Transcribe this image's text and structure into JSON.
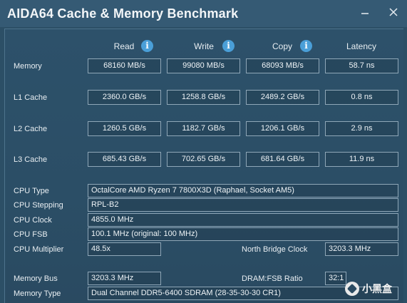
{
  "window": {
    "title": "AIDA64 Cache & Memory Benchmark"
  },
  "columns": {
    "read": "Read",
    "write": "Write",
    "copy": "Copy",
    "latency": "Latency"
  },
  "rows": {
    "memory": {
      "label": "Memory",
      "read": "68160 MB/s",
      "write": "99080 MB/s",
      "copy": "68093 MB/s",
      "latency": "58.7 ns"
    },
    "l1": {
      "label": "L1 Cache",
      "read": "2360.0 GB/s",
      "write": "1258.8 GB/s",
      "copy": "2489.2 GB/s",
      "latency": "0.8 ns"
    },
    "l2": {
      "label": "L2 Cache",
      "read": "1260.5 GB/s",
      "write": "1182.7 GB/s",
      "copy": "1206.1 GB/s",
      "latency": "2.9 ns"
    },
    "l3": {
      "label": "L3 Cache",
      "read": "685.43 GB/s",
      "write": "702.65 GB/s",
      "copy": "681.64 GB/s",
      "latency": "11.9 ns"
    }
  },
  "info": {
    "cpu_type": {
      "label": "CPU Type",
      "value": "OctalCore AMD Ryzen 7 7800X3D  (Raphael, Socket AM5)"
    },
    "cpu_stepping": {
      "label": "CPU Stepping",
      "value": "RPL-B2"
    },
    "cpu_clock": {
      "label": "CPU Clock",
      "value": "4855.0 MHz"
    },
    "cpu_fsb": {
      "label": "CPU FSB",
      "value": "100.1 MHz  (original: 100 MHz)"
    },
    "cpu_multiplier": {
      "label": "CPU Multiplier",
      "value": "48.5x"
    },
    "north_bridge": {
      "label": "North Bridge Clock",
      "value": "3203.3 MHz"
    },
    "memory_bus": {
      "label": "Memory Bus",
      "value": "3203.3 MHz"
    },
    "dram_fsb": {
      "label": "DRAM:FSB Ratio",
      "value": "32:1"
    },
    "memory_type": {
      "label": "Memory Type",
      "value": "Dual Channel DDR5-6400 SDRAM  (28-35-30-30 CR1)"
    }
  },
  "watermark": {
    "text": "小黑盒"
  },
  "colors": {
    "background": "#2c4f66",
    "info_icon": "#4a9fd8",
    "box_border": "#8fa7b8"
  }
}
